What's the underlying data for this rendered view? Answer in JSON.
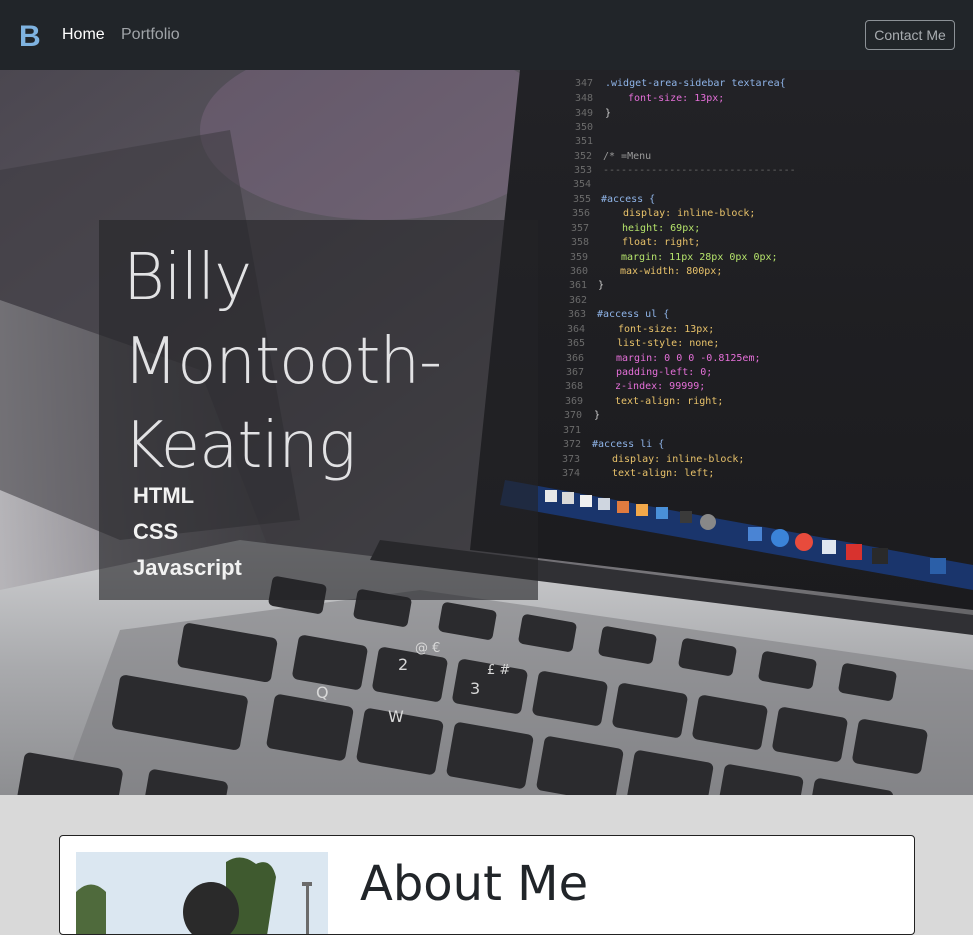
{
  "navbar": {
    "brand_letter": "B",
    "brand_icon": "bootstrap-logo-icon",
    "links": [
      {
        "label": "Home",
        "active": true
      },
      {
        "label": "Portfolio",
        "active": false
      }
    ],
    "contact_label": "Contact Me"
  },
  "hero": {
    "name": "Billy Montooth-Keating",
    "skills": [
      "HTML",
      "CSS",
      "Javascript"
    ],
    "code_lines": [
      {
        "num": "347",
        "text": ".widget-area-sidebar textarea{"
      },
      {
        "num": "348",
        "text": "font-size: 13px;"
      },
      {
        "num": "349",
        "text": "}"
      },
      {
        "num": "350",
        "text": ""
      },
      {
        "num": "351",
        "text": ""
      },
      {
        "num": "352",
        "text": "/* =Menu"
      },
      {
        "num": "353",
        "text": "--------------------------------"
      },
      {
        "num": "354",
        "text": ""
      },
      {
        "num": "355",
        "text": "#access {"
      },
      {
        "num": "356",
        "text": "display: inline-block;"
      },
      {
        "num": "357",
        "text": "height: 69px;"
      },
      {
        "num": "358",
        "text": "float: right;"
      },
      {
        "num": "359",
        "text": "margin: 11px 28px 0px 0px;"
      },
      {
        "num": "360",
        "text": "max-width: 800px;"
      },
      {
        "num": "361",
        "text": "}"
      },
      {
        "num": "362",
        "text": ""
      },
      {
        "num": "363",
        "text": "#access ul {"
      },
      {
        "num": "364",
        "text": "font-size: 13px;"
      },
      {
        "num": "365",
        "text": "list-style: none;"
      },
      {
        "num": "366",
        "text": "margin: 0 0 0 -0.8125em;"
      },
      {
        "num": "367",
        "text": "padding-left: 0;"
      },
      {
        "num": "368",
        "text": "z-index: 99999;"
      },
      {
        "num": "369",
        "text": "text-align: right;"
      },
      {
        "num": "370",
        "text": "}"
      },
      {
        "num": "371",
        "text": ""
      },
      {
        "num": "372",
        "text": "#access li {"
      },
      {
        "num": "373",
        "text": "display: inline-block;"
      },
      {
        "num": "374",
        "text": "text-align: left;"
      }
    ],
    "keys": [
      "Q",
      "W",
      "2",
      "3",
      "@ €",
      "£ #"
    ]
  },
  "about": {
    "title": "About Me"
  },
  "colors": {
    "navbar_bg": "#212529",
    "brand": "#7fb3e0",
    "page_bg": "#d9d9d9",
    "panel_bg": "rgba(35,35,38,0.62)"
  }
}
